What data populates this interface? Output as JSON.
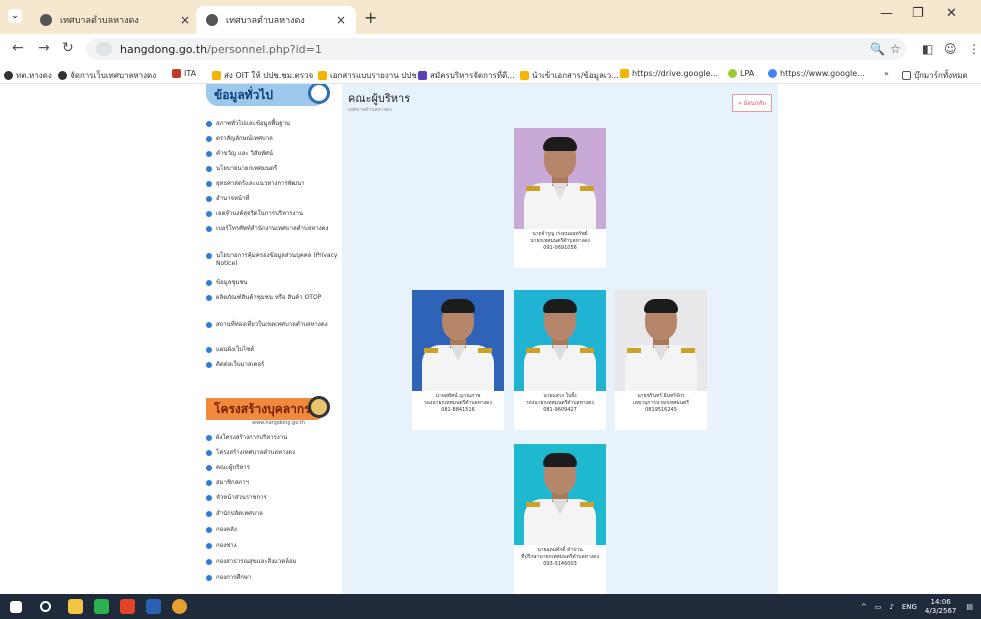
{
  "browser": {
    "tabs": [
      {
        "label": "เทศบาลตำบลหางดง",
        "active": false
      },
      {
        "label": "เทศบาลตำบลหางดง",
        "active": true
      }
    ],
    "url_host": "hangdong.go.th",
    "url_path": "/personnel.php?id=1",
    "bookmarks": [
      "ทต.หางดง",
      "จัดการเว็บเทศบาลหางดง",
      "ITA",
      "ส่ง OIT ให้ ปปช.ชม.ตรวจ",
      "เอกสารแบบรายงาน ปปช...",
      "สมัครบริหารจัดการที่ดี...",
      "นำเข้าเอกสาร/ข้อมูลเว...",
      "https://drive.google...",
      "LPA",
      "https://www.google..."
    ],
    "bookmarks_folder": "บุ๊กมาร์กทั้งหมด"
  },
  "sidebar": {
    "general_heading": "ข้อมูลทั่วไป",
    "general_items": [
      "สภาพทั่วไปและข้อมูลพื้นฐาน",
      "ตราสัญลักษณ์เทศบาล",
      "คำขวัญ และ วิสัยทัศน์",
      "นโยบายนายกเทศมนตรี",
      "ยุทธศาสตร์และแนวทางการพัฒนา",
      "อำนาจหน้าที่",
      "เจตจำนงค์สุจริตในการบริหารงาน",
      "เบอร์โทรศัพท์สำนักงานเทศบาลตำบลหางดง",
      "นโยบายการคุ้มครองข้อมูลส่วนบุคคล (Privacy Notice)",
      "ข้อมูลชุมชน",
      "ผลิตภัณฑ์สินค้าชุมชน หรือ สินค้า OTOP",
      "สถานที่ท่องเที่ยวในเขตเทศบาลตำบลหางดง",
      "แผนผังเว็บไซต์",
      "ติดต่อเว็บมาสเตอร์"
    ],
    "structure_heading": "โครงสร้างบุคลากร",
    "structure_sub": "www.hangdong.go.th",
    "structure_items": [
      "ผังโครงสร้างการบริหารงาน",
      "โครงสร้างเทศบาลตำบลหางดง",
      "คณะผู้บริหาร",
      "สมาชิกสภาฯ",
      "หัวหน้าส่วนราชการ",
      "สำนักปลัดเทศบาล",
      "กองคลัง",
      "กองช่าง",
      "กองสาธารณสุขและสิ่งแวดล้อม",
      "กองการศึกษา"
    ]
  },
  "content": {
    "title": "คณะผู้บริหาร",
    "subtitle": "เทศบาลตำบลหางดง",
    "back_label": "« ย้อนกลับ",
    "people": [
      {
        "name": "นายจำรูญ เร่งถนอมทรัพย์",
        "position": "นายกเทศมนตรีตำบลหางดง",
        "phone": "091-0691056",
        "bg": "#c9a9d6"
      },
      {
        "name": "นายสุทัศน์ ญาณภาพ",
        "position": "รองนายกเทศมนตรีตำบลหางดง",
        "phone": "081-8841516",
        "bg": "#2f63b8"
      },
      {
        "name": "นายแสวง ใบยั้ง",
        "position": "รองนายกเทศมนตรีตำบลหางดง",
        "phone": "081-9609427",
        "bg": "#21b3d3"
      },
      {
        "name": "นายชรินทร์ อินทร์จักร",
        "position": "เลขานุการนายกเทศมนตรี",
        "phone": "0819516245",
        "bg": "#e8e8ea"
      },
      {
        "name": "นายอุดมศักดิ์ คำปวน",
        "position": "ที่ปรึกษานายกเทศมนตรีตำบลหางดง",
        "phone": "093-3146003",
        "bg": "#1fb8d1"
      }
    ]
  },
  "taskbar": {
    "lang": "ENG",
    "time": "14:06",
    "date": "4/3/2567"
  }
}
